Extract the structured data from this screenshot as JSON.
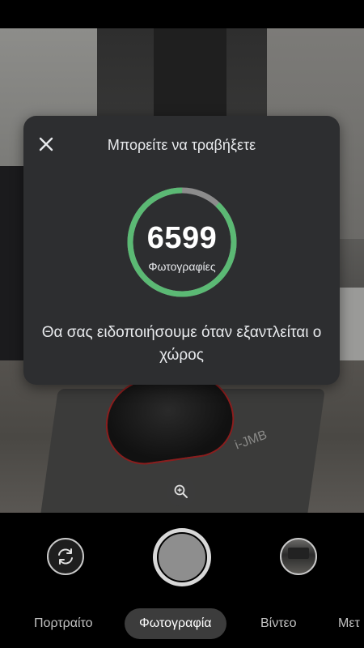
{
  "dialog": {
    "title": "Μπορείτε να τραβήξετε",
    "count": "6599",
    "count_label": "Φωτογραφίες",
    "message": "Θα σας ειδοποιήσουμε όταν εξαντλείται ο χώρος",
    "ring_fraction": 0.88,
    "ring_color": "#5bb974",
    "ring_track_color": "#8c8c8c"
  },
  "preview": {
    "logo_text": "i-JMB"
  },
  "icons": {
    "close": "close-icon",
    "zoom": "zoom-in-icon",
    "switch_camera": "switch-camera-icon"
  },
  "modes": [
    {
      "label": "Πορτραίτο"
    },
    {
      "label": "Φωτογραφία"
    },
    {
      "label": "Βίντεο"
    },
    {
      "label": "Μετ"
    }
  ]
}
